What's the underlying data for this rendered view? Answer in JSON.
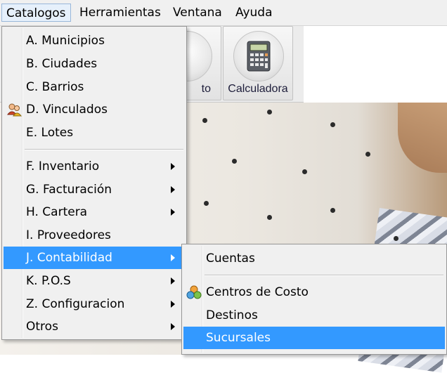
{
  "menubar": {
    "items": [
      {
        "label": "Catalogos"
      },
      {
        "label": "Herramientas"
      },
      {
        "label": "Ventana"
      },
      {
        "label": "Ayuda"
      }
    ]
  },
  "toolbar": {
    "buttons": [
      {
        "label": "to",
        "icon": "blank-circle-icon"
      },
      {
        "label": "Calculadora",
        "icon": "calculator-icon"
      }
    ]
  },
  "catalogos_menu": {
    "items": [
      {
        "label": "A. Municipios"
      },
      {
        "label": "B. Ciudades"
      },
      {
        "label": "C. Barrios"
      },
      {
        "label": "D. Vinculados",
        "icon": "users-icon"
      },
      {
        "label": "E. Lotes"
      },
      {
        "label": "F.  Inventario",
        "submenu": true
      },
      {
        "label": "G. Facturación",
        "submenu": true
      },
      {
        "label": "H. Cartera",
        "submenu": true
      },
      {
        "label": "I.  Proveedores"
      },
      {
        "label": "J. Contabilidad",
        "submenu": true,
        "highlighted": true
      },
      {
        "label": "K. P.O.S",
        "submenu": true
      },
      {
        "label": "Z. Configuracion",
        "submenu": true
      },
      {
        "label": "Otros",
        "submenu": true
      }
    ]
  },
  "contabilidad_submenu": {
    "items": [
      {
        "label": "Cuentas"
      },
      {
        "label": "Centros de Costo",
        "icon": "cost-centers-icon"
      },
      {
        "label": "Destinos"
      },
      {
        "label": "Sucursales",
        "highlighted": true
      }
    ]
  },
  "colors": {
    "highlight": "#3399ff",
    "menu_bg": "#f0f0f0",
    "menubar_open_bg": "#e6f0fb"
  }
}
